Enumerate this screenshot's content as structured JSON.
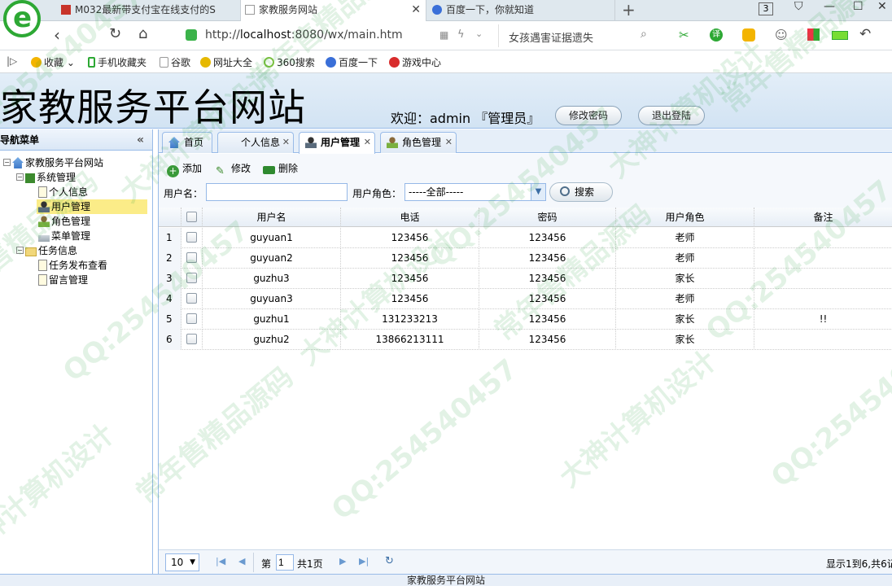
{
  "browser": {
    "tabs": [
      {
        "title": "M032最新带支付宝在线支付的S"
      },
      {
        "title": "家教服务网站",
        "active": true
      },
      {
        "title": "百度一下，你就知道"
      }
    ],
    "new_tab": "+",
    "tab_count": "3",
    "url_host": "http://",
    "url_bold": "localhost",
    "url_rest": ":8080/wx/main.htm",
    "search_text": "女孩遇害证据遗失",
    "bookmarks": [
      "收藏",
      "手机收藏夹",
      "谷歌",
      "网址大全",
      "360搜索",
      "百度一下",
      "游戏中心"
    ]
  },
  "header": {
    "title": "家教服务平台网站",
    "welcome": "欢迎：admin 『管理员』",
    "change_password": "修改密码",
    "logout": "退出登陆"
  },
  "nav": {
    "title": "导航菜单",
    "collapse": "«",
    "root": "家教服务平台网站",
    "system": "系统管理",
    "items1": [
      "个人信息",
      "用户管理",
      "角色管理",
      "菜单管理"
    ],
    "tasks": "任务信息",
    "items2": [
      "任务发布查看",
      "留言管理"
    ]
  },
  "tabs": [
    {
      "label": "首页",
      "closable": false
    },
    {
      "label": "个人信息",
      "closable": true
    },
    {
      "label": "用户管理",
      "closable": true,
      "active": true
    },
    {
      "label": "角色管理",
      "closable": true
    }
  ],
  "toolbar": {
    "add": "添加",
    "edit": "修改",
    "delete": "删除",
    "username_label": "用户名：",
    "username_value": "",
    "role_label": "用户角色：",
    "role_value": "-----全部-----",
    "search": "搜索"
  },
  "grid": {
    "columns": [
      "用户名",
      "电话",
      "密码",
      "用户角色",
      "备注"
    ],
    "rows": [
      {
        "n": "1",
        "username": "guyuan1",
        "phone": "123456",
        "password": "123456",
        "role": "老师",
        "note": ""
      },
      {
        "n": "2",
        "username": "guyuan2",
        "phone": "123456",
        "password": "123456",
        "role": "老师",
        "note": ""
      },
      {
        "n": "3",
        "username": "guzhu3",
        "phone": "123456",
        "password": "123456",
        "role": "家长",
        "note": ""
      },
      {
        "n": "4",
        "username": "guyuan3",
        "phone": "123456",
        "password": "123456",
        "role": "老师",
        "note": ""
      },
      {
        "n": "5",
        "username": "guzhu1",
        "phone": "131233213",
        "password": "123456",
        "role": "家长",
        "note": "!!"
      },
      {
        "n": "6",
        "username": "guzhu2",
        "phone": "13866213111",
        "password": "123456",
        "role": "家长",
        "note": ""
      }
    ]
  },
  "pager": {
    "page_size": "10",
    "page_prefix": "第",
    "page": "1",
    "page_total": "共1页",
    "info": "显示1到6,共6记"
  },
  "footer": "家教服务平台网站",
  "watermarks": [
    "QQ:254540457",
    "大神计算机设计",
    "常年售精品源码"
  ],
  "colors": {
    "accent": "#99bbe8",
    "selected": "#fbec88",
    "logo": "#2da834"
  }
}
